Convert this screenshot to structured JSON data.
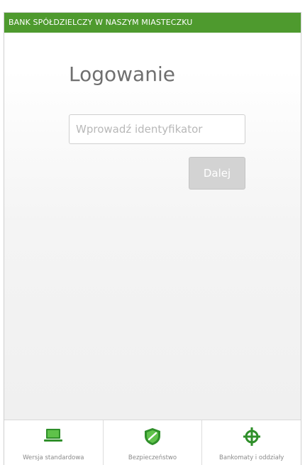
{
  "header": {
    "bank_name": "BANK SPÓŁDZIELCZY W NASZYM MIASTECZKU"
  },
  "login": {
    "title": "Logowanie",
    "id_placeholder": "Wprowadź identyfikator",
    "id_value": "",
    "next_label": "Dalej"
  },
  "footer": {
    "items": [
      {
        "label": "Wersja standardowa",
        "icon": "laptop-icon"
      },
      {
        "label": "Bezpieczeństwo",
        "icon": "shield-icon"
      },
      {
        "label": "Bankomaty i oddziały",
        "icon": "crosshair-icon"
      }
    ]
  },
  "colors": {
    "brand_green": "#4e9a2e",
    "button_disabled": "#d3d3d3",
    "title_gray": "#6f6f6f"
  }
}
